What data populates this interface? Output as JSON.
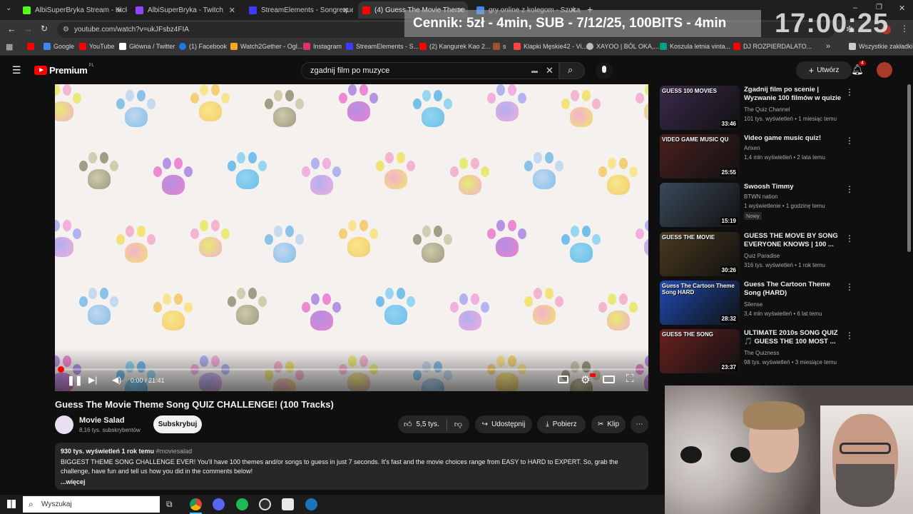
{
  "tabs": [
    {
      "label": "AlbiSuperBryka Stream - Kick D",
      "color": "#53fc18"
    },
    {
      "label": "AlbiSuperBryka - Twitch",
      "color": "#9146ff"
    },
    {
      "label": "StreamElements - Songrequest",
      "color": "#3c3cff"
    },
    {
      "label": "(4) Guess The Movie Theme",
      "color": "#ff0000"
    },
    {
      "label": "gry online z kolegom - Szukaj",
      "color": "#4285f4"
    }
  ],
  "address": {
    "url": "youtube.com/watch?v=ukJFsbz4FIA"
  },
  "bookmarks": [
    {
      "label": "",
      "color": "#ff0000"
    },
    {
      "label": "Google",
      "color": "#4285f4"
    },
    {
      "label": "YouTube",
      "color": "#ff0000"
    },
    {
      "label": "Główna / Twitter",
      "color": "#ffffff"
    },
    {
      "label": "(1) Facebook",
      "color": "#1877f2"
    },
    {
      "label": "Watch2Gether - Ogl...",
      "color": "#f5a623"
    },
    {
      "label": "Instagram",
      "color": "#e1306c"
    },
    {
      "label": "StreamElements - S...",
      "color": "#3c3cff"
    },
    {
      "label": "(2) Kangurek Kao 2...",
      "color": "#ff0000"
    },
    {
      "label": "s",
      "color": "#a0522d"
    },
    {
      "label": "Klapki Męskie42 - Vi...",
      "color": "#ff4444"
    },
    {
      "label": "XAYOO | BÓL OKA,...",
      "color": "#bbbbbb"
    },
    {
      "label": "Koszula letnia vinta...",
      "color": "#00a08a"
    },
    {
      "label": "DJ ROZPIERDALATO...",
      "color": "#ff0000"
    },
    {
      "label": "Wszystkie zakładki",
      "color": "#cccccc"
    }
  ],
  "youtube": {
    "logo": "Premium",
    "logo_badge": "PL",
    "search_value": "zgadnij film po muzyce",
    "create_label": "Utwórz",
    "notif_count": "4"
  },
  "player": {
    "time": "0:00 / 21:41",
    "progress_fraction": 0.0
  },
  "video": {
    "title": "Guess The Movie Theme Song QUIZ CHALLENGE! (100 Tracks)",
    "channel": "Movie Salad",
    "subs": "8,16 tys. subskrybentów",
    "subscribe": "Subskrybuj",
    "likes": "5,5 tys.",
    "share": "Udostępnij",
    "download": "Pobierz",
    "clip": "Klip",
    "meta": "930 tys. wyświetleń  1 rok temu",
    "hashtag": "#moviesalad",
    "description": "BIGGEST THEME SONG CHALLENGE EVER! You'll have 100 themes and/or songs to guess in just 7 seconds. It's fast and the movie choices range from EASY to HARD to EXPERT. So, grab the challenge, have fun and tell us how you did in the comments below!",
    "more": "...więcej"
  },
  "recommendations": [
    {
      "title": "Zgadnij film po scenie | Wyzwanie 100 filmów w quizie",
      "channel": "The Quiz Channel",
      "meta": "101 tys. wyświetleń • 1 miesiąc temu",
      "duration": "33:46",
      "badge": "",
      "color": "#3a2a4a",
      "thumb_text": "GUESS 100 MOVIES"
    },
    {
      "title": "Video game music quiz!",
      "channel": "Arixen",
      "meta": "1,4 mln wyświetleń • 2 lata temu",
      "duration": "25:55",
      "badge": "",
      "color": "#4a2020",
      "thumb_text": "VIDEO GAME MUSIC QU"
    },
    {
      "title": "Swoosh Timmy",
      "channel": "BTWN nation",
      "meta": "1 wyświetlenie • 1 godzinę temu",
      "duration": "15:19",
      "badge": "Nowy",
      "color": "#3a4a5a",
      "thumb_text": ""
    },
    {
      "title": "GUESS THE MOVE BY SONG EVERYONE KNOWS | 100 ...",
      "channel": "Quiz Paradise",
      "meta": "316 tys. wyświetleń • 1 rok temu",
      "duration": "30:26",
      "badge": "",
      "color": "#4a3a20",
      "thumb_text": "GUESS THE MOVIE"
    },
    {
      "title": "Guess The Cartoon Theme Song (HARD)",
      "channel": "Silense",
      "meta": "3,4 mln wyświetleń • 6 lat temu",
      "duration": "28:32",
      "badge": "",
      "color": "#1e4ab0",
      "thumb_text": "Guess The Cartoon Theme Song HARD"
    },
    {
      "title": "ULTIMATE 2010s SONG QUIZ 🎵 GUESS THE 100 MOST ...",
      "channel": "The Quizness",
      "meta": "98 tys. wyświetleń • 3 miesiące temu",
      "duration": "23:37",
      "badge": "",
      "color": "#6a2020",
      "thumb_text": "GUESS THE SONG"
    }
  ],
  "overlay": {
    "price_text": "Cennik: 5zł - 4min, SUB - 7/12/25, 100BITS - 4min",
    "clock": "17:00:25"
  },
  "taskbar": {
    "search_placeholder": "Wyszukaj"
  }
}
